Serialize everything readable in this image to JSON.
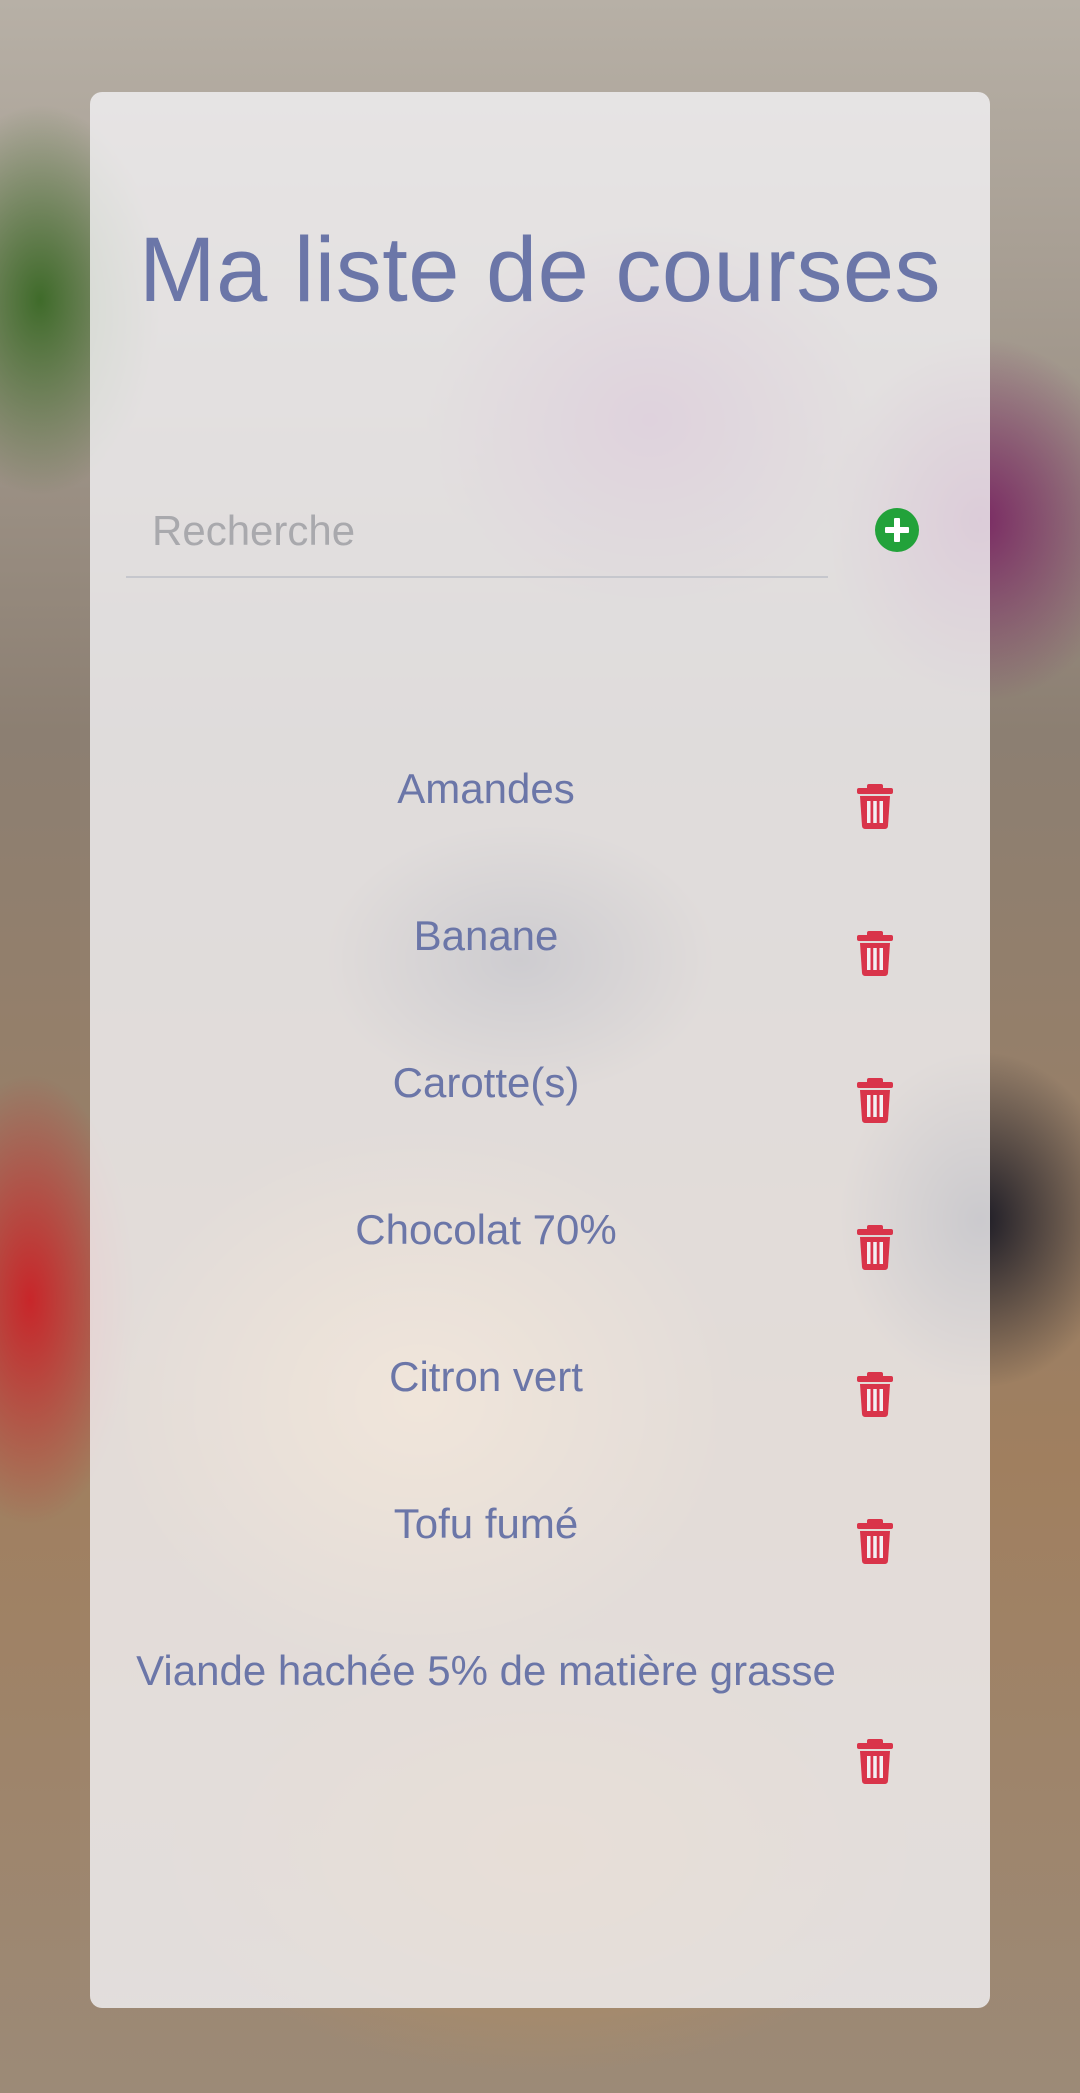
{
  "header": {
    "title": "Ma liste de courses"
  },
  "search": {
    "placeholder": "Recherche",
    "value": ""
  },
  "actions": {
    "add_icon": "plus-circle-icon",
    "delete_icon": "trash-icon"
  },
  "colors": {
    "title": "#6b76a8",
    "add": "#22a23a",
    "delete": "#d9344a"
  },
  "items": [
    {
      "label": "Amandes"
    },
    {
      "label": "Banane"
    },
    {
      "label": "Carotte(s)"
    },
    {
      "label": "Chocolat 70%"
    },
    {
      "label": "Citron vert"
    },
    {
      "label": "Tofu fumé"
    },
    {
      "label": "Viande hachée 5% de matière grasse"
    }
  ]
}
